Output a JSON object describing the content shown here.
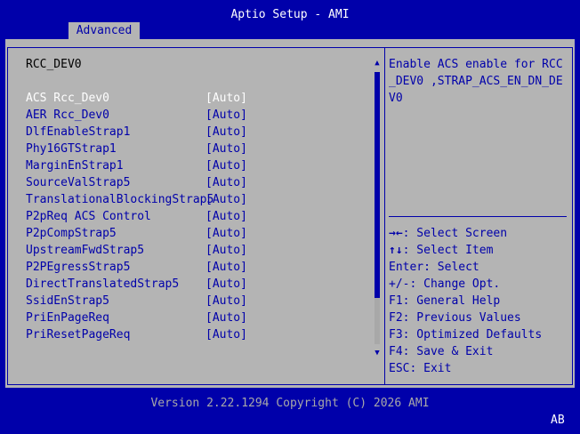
{
  "header": {
    "title": "Aptio Setup - AMI",
    "tabs": [
      {
        "label": "Advanced",
        "active": true
      }
    ]
  },
  "main": {
    "section_title": "RCC_DEV0",
    "items": [
      {
        "label": "ACS Rcc_Dev0",
        "value": "[Auto]",
        "selected": true
      },
      {
        "label": "AER Rcc_Dev0",
        "value": "[Auto]"
      },
      {
        "label": "DlfEnableStrap1",
        "value": "[Auto]"
      },
      {
        "label": "Phy16GTStrap1",
        "value": "[Auto]"
      },
      {
        "label": "MarginEnStrap1",
        "value": "[Auto]"
      },
      {
        "label": "SourceValStrap5",
        "value": "[Auto]"
      },
      {
        "label": "TranslationalBlockingStrap5",
        "value": "[Auto]"
      },
      {
        "label": "P2pReq ACS Control",
        "value": "[Auto]"
      },
      {
        "label": "P2pCompStrap5",
        "value": "[Auto]"
      },
      {
        "label": "UpstreamFwdStrap5",
        "value": "[Auto]"
      },
      {
        "label": "P2PEgressStrap5",
        "value": "[Auto]"
      },
      {
        "label": "DirectTranslatedStrap5",
        "value": "[Auto]"
      },
      {
        "label": "SsidEnStrap5",
        "value": "[Auto]"
      },
      {
        "label": "PriEnPageReq",
        "value": "[Auto]"
      },
      {
        "label": "PriResetPageReq",
        "value": "[Auto]"
      }
    ]
  },
  "help": {
    "text": "Enable ACS enable for RCC_DEV0 ,STRAP_ACS_EN_DN_DEV0",
    "keys": [
      {
        "key": "→←",
        "desc": ": Select Screen"
      },
      {
        "key": "↑↓",
        "desc": ": Select Item"
      },
      {
        "key": "Enter",
        "desc": ": Select"
      },
      {
        "key": "+/-",
        "desc": ": Change Opt."
      },
      {
        "key": "F1",
        "desc": ": General Help"
      },
      {
        "key": "F2",
        "desc": ": Previous Values"
      },
      {
        "key": "F3",
        "desc": ": Optimized Defaults"
      },
      {
        "key": "F4",
        "desc": ": Save & Exit"
      },
      {
        "key": "ESC",
        "desc": ": Exit"
      }
    ]
  },
  "footer": {
    "version": "Version 2.22.1294 Copyright (C) 2026 AMI",
    "badge": "AB"
  },
  "scrollbar": {
    "up_icon": "▲",
    "down_icon": "▼"
  },
  "colors": {
    "background": "#0000aa",
    "panel": "#b4b4b4",
    "text": "#0000aa",
    "selected": "#ffffff"
  }
}
